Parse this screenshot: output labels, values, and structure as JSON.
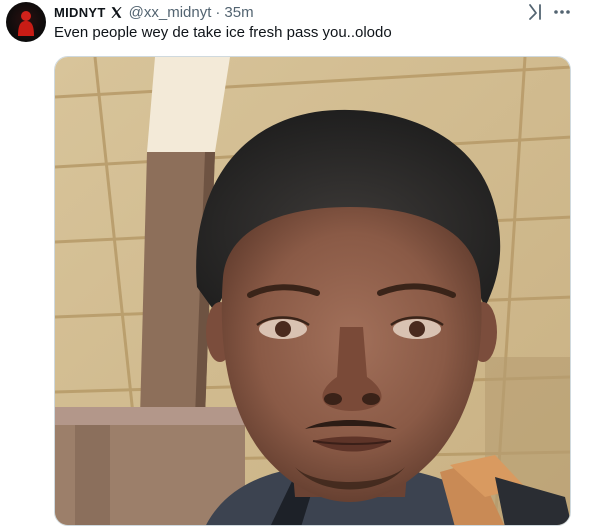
{
  "tweet": {
    "display_name": "MIDNYT",
    "handle": "@xx_midnyt",
    "separator": "·",
    "time": "35m",
    "text": "Even people wey de take ice fresh pass you..olodo",
    "verified_badge_icon": "x-logo-icon",
    "media_alt_icon": "photo"
  },
  "actions": {
    "grok_icon": "grok-icon",
    "more_icon": "more-options-icon"
  },
  "colors": {
    "text_primary": "#0f1419",
    "text_secondary": "#536471",
    "border": "#cfd9de",
    "avatar_accent": "#d1221b"
  }
}
